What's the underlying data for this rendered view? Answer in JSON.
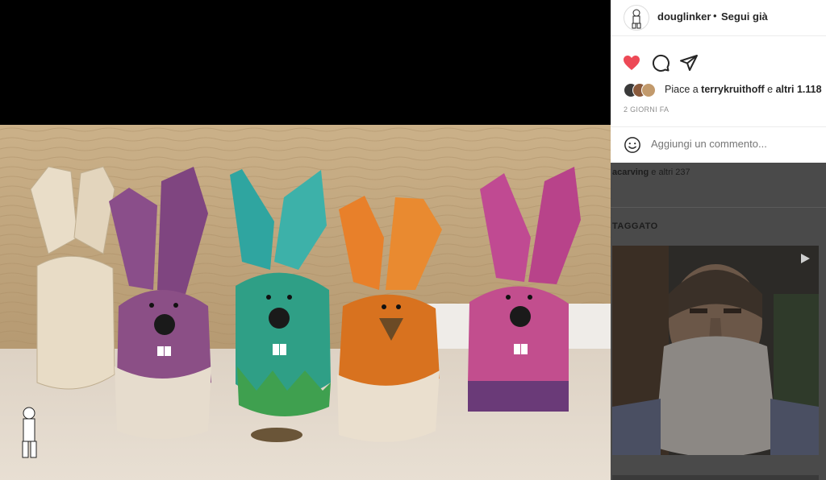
{
  "post": {
    "username": "douglinker",
    "separator": "•",
    "follow_status": "Segui già",
    "likes": {
      "prefix": "Piace a ",
      "user": "terrykruithoff",
      "middle": " e ",
      "others": "altri 1.118"
    },
    "date": "2 GIORNI FA",
    "comment_placeholder": "Aggiungi un commento..."
  },
  "background": {
    "liked_partial": {
      "user": "acarving",
      "rest": " e altri 237"
    },
    "tagged_heading": "TAGGATO"
  },
  "icons": {
    "like": "heart-icon",
    "comment": "comment-bubble-icon",
    "share": "paper-plane-icon",
    "emoji": "smiley-icon",
    "video": "play-icon"
  },
  "colors": {
    "like_red": "#ed4956",
    "text_primary": "#262626",
    "text_secondary": "#8e8e8e",
    "overlay": "#4a4a4a"
  }
}
